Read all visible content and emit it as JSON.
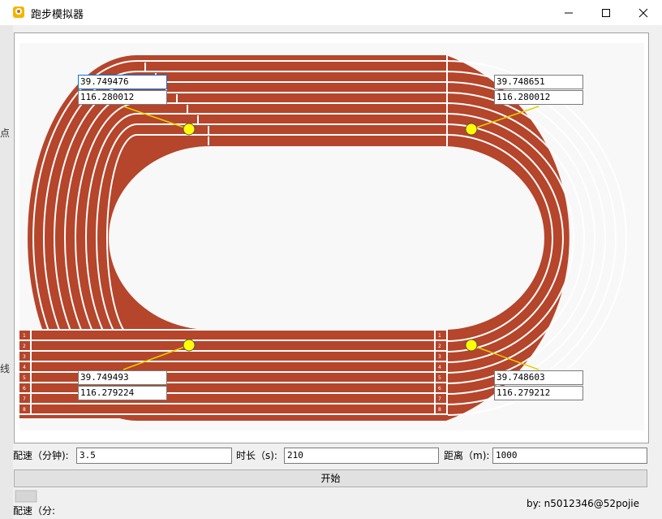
{
  "window": {
    "title": "跑步模拟器"
  },
  "coords": {
    "top_left": {
      "lat": "39.749476",
      "lng": "116.280012"
    },
    "top_right": {
      "lat": "39.748651",
      "lng": "116.280012"
    },
    "bottom_left": {
      "lat": "39.749493",
      "lng": "116.279224"
    },
    "bottom_right": {
      "lat": "39.748603",
      "lng": "116.279212"
    }
  },
  "form": {
    "pace_label": "配速（分钟):",
    "pace_value": "3.5",
    "duration_label": "时长（s):",
    "duration_value": "210",
    "distance_label": "距离（m):",
    "distance_value": "1000",
    "start_label": "开始"
  },
  "status": {
    "author": "by: n5012346@52pojie",
    "pace_status_label": "配速（分:"
  },
  "lane_numbers": [
    "1",
    "2",
    "3",
    "4",
    "5",
    "6",
    "7",
    "8"
  ],
  "colors": {
    "track": "#b5452b",
    "lines": "#ffffff",
    "marker": "#ffff00",
    "connector": "#e6d000"
  },
  "background_fragments": [
    "点",
    "线"
  ]
}
